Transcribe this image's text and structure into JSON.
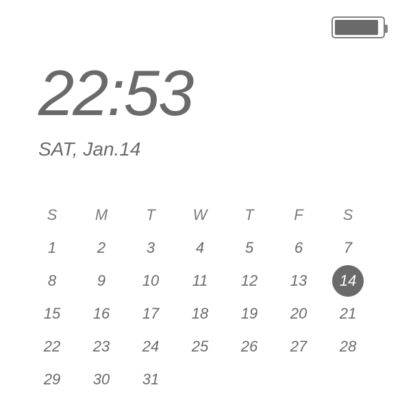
{
  "battery": {
    "level_percent": 92
  },
  "clock": {
    "time": "22:53",
    "date": "SAT, Jan.14"
  },
  "calendar": {
    "weekdays": [
      "S",
      "M",
      "T",
      "W",
      "T",
      "F",
      "S"
    ],
    "today": 14,
    "weeks": [
      [
        1,
        2,
        3,
        4,
        5,
        6,
        7
      ],
      [
        8,
        9,
        10,
        11,
        12,
        13,
        14
      ],
      [
        15,
        16,
        17,
        18,
        19,
        20,
        21
      ],
      [
        22,
        23,
        24,
        25,
        26,
        27,
        28
      ],
      [
        29,
        30,
        31,
        null,
        null,
        null,
        null
      ]
    ]
  }
}
